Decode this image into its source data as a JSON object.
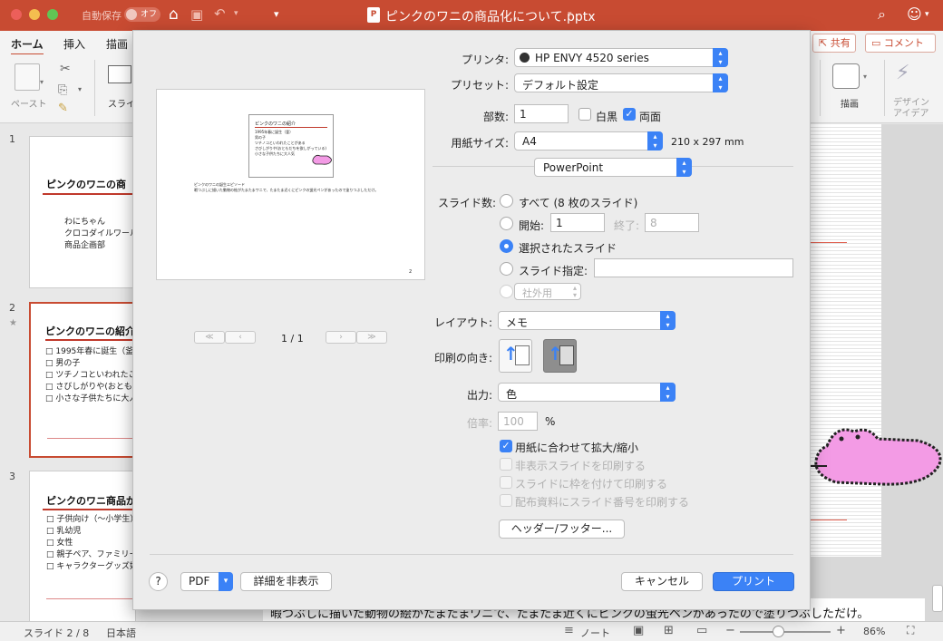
{
  "window": {
    "title": "ピンクのワニの商品化について.pptx",
    "autosave_label": "自動保存",
    "autosave_state": "オフ"
  },
  "ribbon": {
    "tabs": [
      "ホーム",
      "挿入",
      "描画"
    ],
    "paste_label": "ペースト",
    "slide_label": "スライ",
    "draw_label": "描画",
    "design_label_1": "デザイン",
    "design_label_2": "アイデア",
    "share_label": "共有",
    "comment_label": "コメント"
  },
  "thumbnails": [
    {
      "num": "1",
      "title": "ピンクのワニの商",
      "lines": [
        "わにちゃん",
        "クロコダイルワールド",
        "商品企画部"
      ]
    },
    {
      "num": "2",
      "title": "ピンクのワニの紹介",
      "lines": [
        "□ 1995年春に誕生（釜",
        "□ 男の子",
        "□ ツチノコといわれたこと",
        "□ さびしがりや(おともだ",
        "□ 小さな子供たちに大人"
      ]
    },
    {
      "num": "3",
      "title": "ピンクのワニ商品が",
      "lines": [
        "□ 子供向け（～小学生）",
        "□ 乳幼児",
        "□ 女性",
        "□ 親子ペア、ファミリー",
        "□ キャラクターグッズ好き"
      ]
    }
  ],
  "notes_text": "暇つぶしに描いた動物の絵がたまたまワニで、たまたま近くにピンクの蛍光ペンがあったので塗りつぶしただけ。",
  "status": {
    "slide": "スライド 2 / 8",
    "language": "日本語",
    "notes": "ノート",
    "zoom": "86%"
  },
  "dialog": {
    "printer_label": "プリンタ:",
    "printer_value": "HP ENVY 4520 series",
    "preset_label": "プリセット:",
    "preset_value": "デフォルト設定",
    "copies_label": "部数:",
    "copies_value": "1",
    "bw_label": "白黒",
    "duplex_label": "両面",
    "paper_label": "用紙サイズ:",
    "paper_value": "A4",
    "paper_dims": "210 x 297 mm",
    "section_value": "PowerPoint",
    "slides_label": "スライド数:",
    "all_label": "すべて  (8 枚のスライド)",
    "from_label": "開始:",
    "from_value": "1",
    "to_label": "終了:",
    "to_value": "8",
    "selected_label": "選択されたスライド",
    "custom_label": "スライド指定:",
    "custom_show": "社外用",
    "layout_label": "レイアウト:",
    "layout_value": "メモ",
    "orientation_label": "印刷の向き:",
    "output_label": "出力:",
    "output_value": "色",
    "scale_label": "倍率:",
    "scale_value": "100",
    "scale_unit": "%",
    "fit_label": "用紙に合わせて拡大/縮小",
    "hidden_label": "非表示スライドを印刷する",
    "frame_label": "スライドに枠を付けて印刷する",
    "number_label": "配布資料にスライド番号を印刷する",
    "header_footer": "ヘッダー/フッター...",
    "page_indicator": "1 / 1",
    "help": "?",
    "pdf": "PDF",
    "hide_details": "詳細を非表示",
    "cancel": "キャンセル",
    "print": "プリント"
  },
  "preview": {
    "title": "ピンクのワニの紹介",
    "lines": [
      "1995年春に誕生（釜）",
      "男の子",
      "ツチノコといわれたことがある",
      "さびしがりや(おともだちを欲しがっている)",
      "小さな子供たちに大人気"
    ],
    "note_1": "ピンクのワニの誕生エピソード",
    "note_2": "暇つぶしに描いた動物の絵がたまたまワニで、たまたま近くにピンクの蛍光ペンがあったので塗りつぶしただけ。",
    "page": "2"
  },
  "colors": {
    "accent": "#c84b32",
    "blue": "#3b82f6",
    "pink": "#f39be5"
  }
}
